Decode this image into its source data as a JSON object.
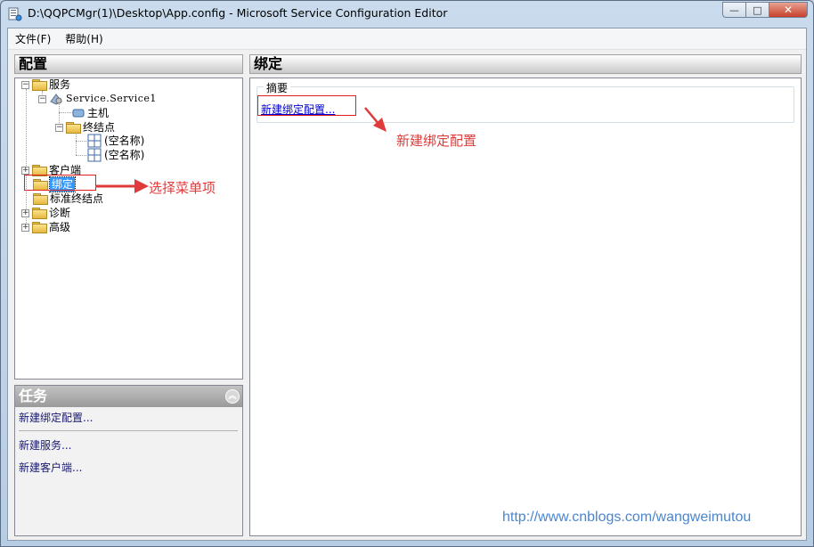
{
  "window": {
    "title": "D:\\QQPCMgr(1)\\Desktop\\App.config - Microsoft Service Configuration Editor",
    "minimize": "—",
    "maximize": "□",
    "close": "✕"
  },
  "menubar": {
    "items": [
      "文件(F)",
      "帮助(H)"
    ]
  },
  "left_pane": {
    "header": "配置",
    "tree": {
      "services": "服务",
      "service1": "Service.Service1",
      "host": "主机",
      "endpoints": "终结点",
      "endpoint1": "(空名称)",
      "endpoint2": "(空名称)",
      "client": "客户端",
      "bindings": "绑定",
      "standard_endpoints": "标准终结点",
      "diagnostics": "诊断",
      "advanced": "高级",
      "expand": "+",
      "collapse": "−"
    }
  },
  "tasks": {
    "header": "任务",
    "collapse": "︽",
    "links": [
      "新建绑定配置...",
      "新建服务...",
      "新建客户端..."
    ]
  },
  "right_pane": {
    "header": "绑定",
    "summary_legend": "摘要",
    "summary_link": "新建绑定配置..."
  },
  "annotations": {
    "select_menu_item": "选择菜单项",
    "new_binding_config": "新建绑定配置",
    "color": "#e03a3a"
  },
  "watermark": "http://www.cnblogs.com/wangweimutou"
}
